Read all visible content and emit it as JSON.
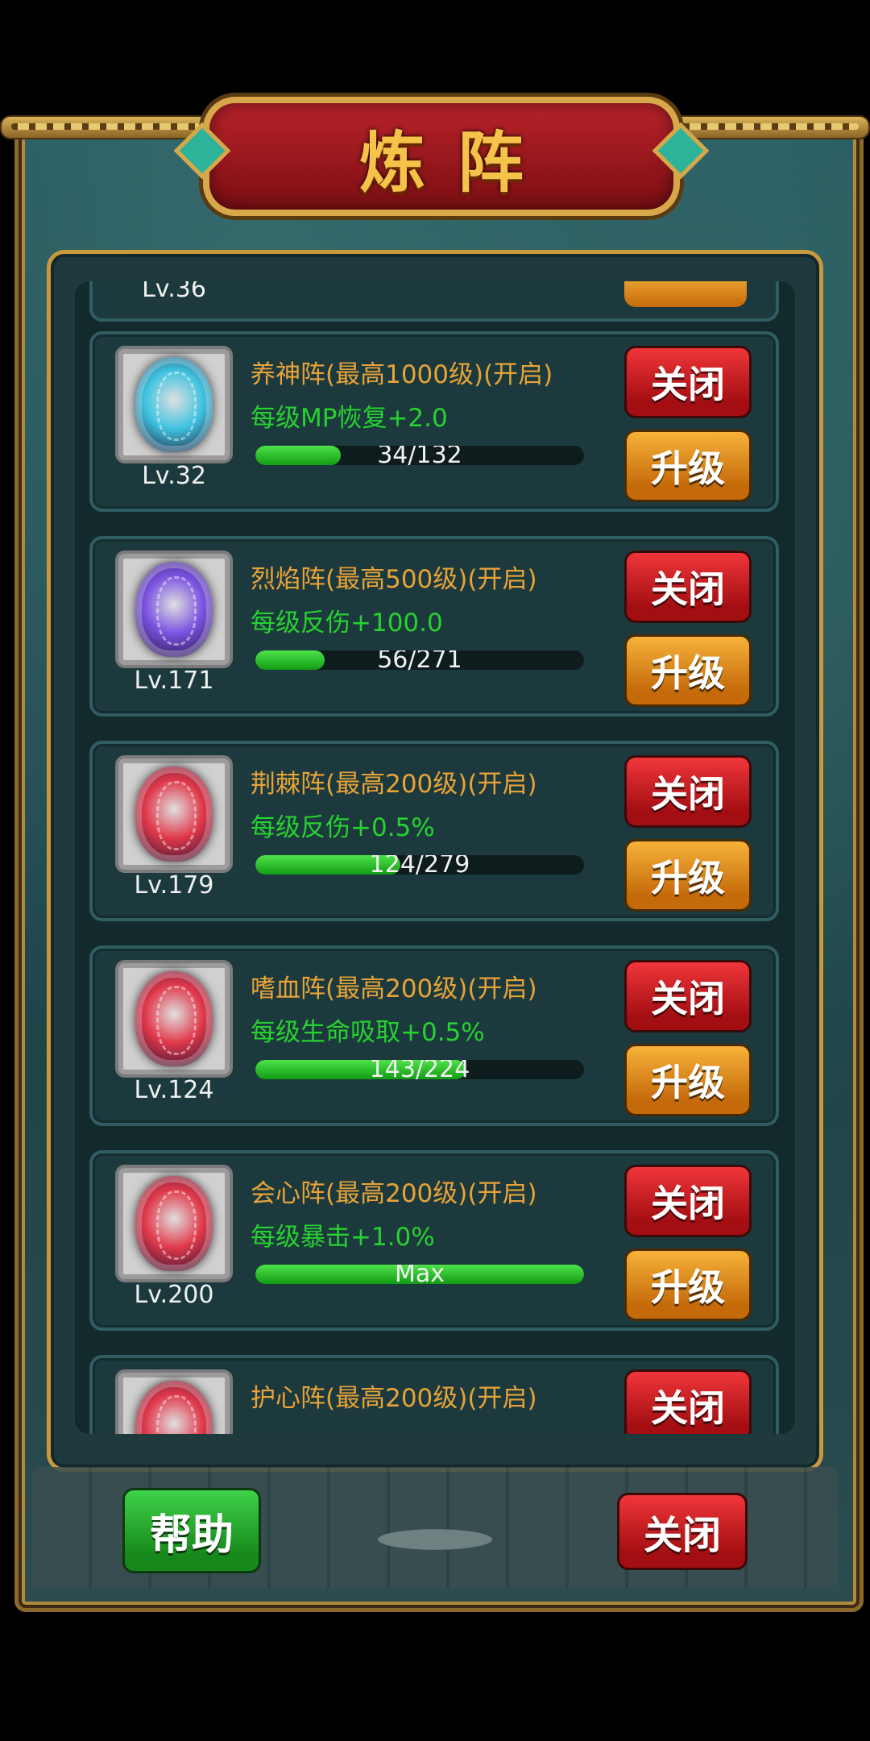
{
  "title": "炼阵",
  "top_partial": {
    "level": "Lv.36"
  },
  "buttons": {
    "close": "关闭",
    "upgrade": "升级",
    "help": "帮助",
    "footer_close": "关闭"
  },
  "formations": [
    {
      "name": "养神阵(最高1000级)(开启)",
      "effect": "每级MP恢复+2.0",
      "progress_text": "34/132",
      "progress": 0.26,
      "level": "Lv.32",
      "gem_color": "#3fc3e0"
    },
    {
      "name": "烈焰阵(最高500级)(开启)",
      "effect": "每级反伤+100.0",
      "progress_text": "56/271",
      "progress": 0.21,
      "level": "Lv.171",
      "gem_color": "#7a52e0"
    },
    {
      "name": "荆棘阵(最高200级)(开启)",
      "effect": "每级反伤+0.5%",
      "progress_text": "124/279",
      "progress": 0.44,
      "level": "Lv.179",
      "gem_color": "#e0384a"
    },
    {
      "name": "嗜血阵(最高200级)(开启)",
      "effect": "每级生命吸取+0.5%",
      "progress_text": "143/224",
      "progress": 0.64,
      "level": "Lv.124",
      "gem_color": "#e0384a"
    },
    {
      "name": "会心阵(最高200级)(开启)",
      "effect": "每级暴击+1.0%",
      "progress_text": "Max",
      "progress": 1.0,
      "level": "Lv.200",
      "gem_color": "#e0384a"
    },
    {
      "name": "护心阵(最高200级)(开启)",
      "effect": "",
      "progress_text": "",
      "progress": 0,
      "level": "",
      "gem_color": "#e0384a"
    }
  ]
}
